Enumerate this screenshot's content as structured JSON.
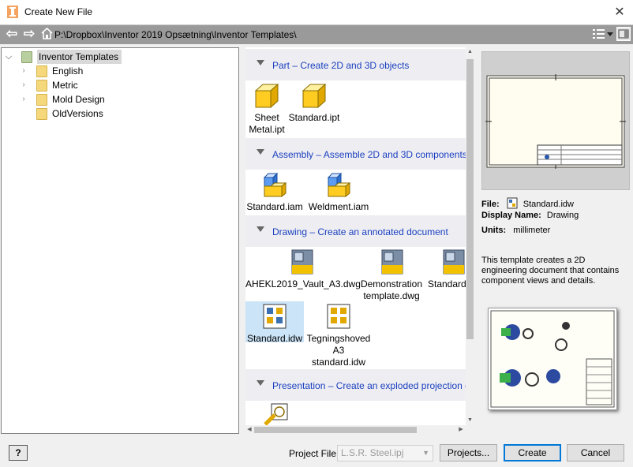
{
  "window": {
    "title": "Create New File",
    "close_glyph": "✕"
  },
  "address": {
    "path": "P:\\Dropbox\\Inventor 2019 Opsætning\\Inventor Templates\\"
  },
  "tree": {
    "root": "Inventor Templates",
    "children": [
      "English",
      "Metric",
      "Mold Design",
      "OldVersions"
    ]
  },
  "categories": {
    "part": {
      "title": "Part – Create 2D and 3D objects",
      "items": [
        "Sheet\nMetal.ipt",
        "Standard.ipt"
      ]
    },
    "assembly": {
      "title": "Assembly – Assemble 2D and 3D components",
      "items": [
        "Standard.iam",
        "Weldment.iam"
      ]
    },
    "drawing": {
      "title": "Drawing – Create an annotated document",
      "items": [
        "AHEKL2019_Vault_A3.dwg",
        "Demonstration template.dwg",
        "Standard",
        "Standard.idw",
        "Tegningshoved A3 standard.idw"
      ]
    },
    "presentation": {
      "title": "Presentation – Create an exploded projection of an"
    }
  },
  "details": {
    "file_label": "File:",
    "file_value": "Standard.idw",
    "display_label": "Display Name:",
    "display_value": "Drawing",
    "units_label": "Units:",
    "units_value": "millimeter",
    "description": "This template creates a 2D engineering document that contains component views and details."
  },
  "footer": {
    "help": "?",
    "project_label": "Project File:",
    "project_value": "L.S.R. Steel.ipj",
    "projects_button": "Projects...",
    "create_button": "Create",
    "cancel_button": "Cancel"
  },
  "colors": {
    "category_title": "#1a3fbf",
    "selection": "#cce4f7",
    "address_bar": "#9a9a9a"
  }
}
